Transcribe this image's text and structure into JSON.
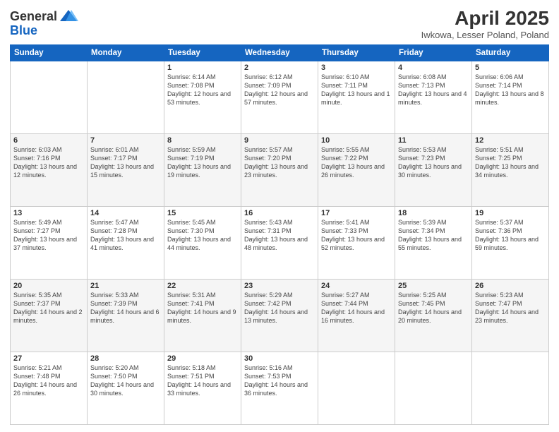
{
  "header": {
    "logo_general": "General",
    "logo_blue": "Blue",
    "title": "April 2025",
    "subtitle": "Iwkowa, Lesser Poland, Poland"
  },
  "days_of_week": [
    "Sunday",
    "Monday",
    "Tuesday",
    "Wednesday",
    "Thursday",
    "Friday",
    "Saturday"
  ],
  "weeks": [
    [
      {
        "day": "",
        "info": ""
      },
      {
        "day": "",
        "info": ""
      },
      {
        "day": "1",
        "info": "Sunrise: 6:14 AM\nSunset: 7:08 PM\nDaylight: 12 hours and 53 minutes."
      },
      {
        "day": "2",
        "info": "Sunrise: 6:12 AM\nSunset: 7:09 PM\nDaylight: 12 hours and 57 minutes."
      },
      {
        "day": "3",
        "info": "Sunrise: 6:10 AM\nSunset: 7:11 PM\nDaylight: 13 hours and 1 minute."
      },
      {
        "day": "4",
        "info": "Sunrise: 6:08 AM\nSunset: 7:13 PM\nDaylight: 13 hours and 4 minutes."
      },
      {
        "day": "5",
        "info": "Sunrise: 6:06 AM\nSunset: 7:14 PM\nDaylight: 13 hours and 8 minutes."
      }
    ],
    [
      {
        "day": "6",
        "info": "Sunrise: 6:03 AM\nSunset: 7:16 PM\nDaylight: 13 hours and 12 minutes."
      },
      {
        "day": "7",
        "info": "Sunrise: 6:01 AM\nSunset: 7:17 PM\nDaylight: 13 hours and 15 minutes."
      },
      {
        "day": "8",
        "info": "Sunrise: 5:59 AM\nSunset: 7:19 PM\nDaylight: 13 hours and 19 minutes."
      },
      {
        "day": "9",
        "info": "Sunrise: 5:57 AM\nSunset: 7:20 PM\nDaylight: 13 hours and 23 minutes."
      },
      {
        "day": "10",
        "info": "Sunrise: 5:55 AM\nSunset: 7:22 PM\nDaylight: 13 hours and 26 minutes."
      },
      {
        "day": "11",
        "info": "Sunrise: 5:53 AM\nSunset: 7:23 PM\nDaylight: 13 hours and 30 minutes."
      },
      {
        "day": "12",
        "info": "Sunrise: 5:51 AM\nSunset: 7:25 PM\nDaylight: 13 hours and 34 minutes."
      }
    ],
    [
      {
        "day": "13",
        "info": "Sunrise: 5:49 AM\nSunset: 7:27 PM\nDaylight: 13 hours and 37 minutes."
      },
      {
        "day": "14",
        "info": "Sunrise: 5:47 AM\nSunset: 7:28 PM\nDaylight: 13 hours and 41 minutes."
      },
      {
        "day": "15",
        "info": "Sunrise: 5:45 AM\nSunset: 7:30 PM\nDaylight: 13 hours and 44 minutes."
      },
      {
        "day": "16",
        "info": "Sunrise: 5:43 AM\nSunset: 7:31 PM\nDaylight: 13 hours and 48 minutes."
      },
      {
        "day": "17",
        "info": "Sunrise: 5:41 AM\nSunset: 7:33 PM\nDaylight: 13 hours and 52 minutes."
      },
      {
        "day": "18",
        "info": "Sunrise: 5:39 AM\nSunset: 7:34 PM\nDaylight: 13 hours and 55 minutes."
      },
      {
        "day": "19",
        "info": "Sunrise: 5:37 AM\nSunset: 7:36 PM\nDaylight: 13 hours and 59 minutes."
      }
    ],
    [
      {
        "day": "20",
        "info": "Sunrise: 5:35 AM\nSunset: 7:37 PM\nDaylight: 14 hours and 2 minutes."
      },
      {
        "day": "21",
        "info": "Sunrise: 5:33 AM\nSunset: 7:39 PM\nDaylight: 14 hours and 6 minutes."
      },
      {
        "day": "22",
        "info": "Sunrise: 5:31 AM\nSunset: 7:41 PM\nDaylight: 14 hours and 9 minutes."
      },
      {
        "day": "23",
        "info": "Sunrise: 5:29 AM\nSunset: 7:42 PM\nDaylight: 14 hours and 13 minutes."
      },
      {
        "day": "24",
        "info": "Sunrise: 5:27 AM\nSunset: 7:44 PM\nDaylight: 14 hours and 16 minutes."
      },
      {
        "day": "25",
        "info": "Sunrise: 5:25 AM\nSunset: 7:45 PM\nDaylight: 14 hours and 20 minutes."
      },
      {
        "day": "26",
        "info": "Sunrise: 5:23 AM\nSunset: 7:47 PM\nDaylight: 14 hours and 23 minutes."
      }
    ],
    [
      {
        "day": "27",
        "info": "Sunrise: 5:21 AM\nSunset: 7:48 PM\nDaylight: 14 hours and 26 minutes."
      },
      {
        "day": "28",
        "info": "Sunrise: 5:20 AM\nSunset: 7:50 PM\nDaylight: 14 hours and 30 minutes."
      },
      {
        "day": "29",
        "info": "Sunrise: 5:18 AM\nSunset: 7:51 PM\nDaylight: 14 hours and 33 minutes."
      },
      {
        "day": "30",
        "info": "Sunrise: 5:16 AM\nSunset: 7:53 PM\nDaylight: 14 hours and 36 minutes."
      },
      {
        "day": "",
        "info": ""
      },
      {
        "day": "",
        "info": ""
      },
      {
        "day": "",
        "info": ""
      }
    ]
  ]
}
